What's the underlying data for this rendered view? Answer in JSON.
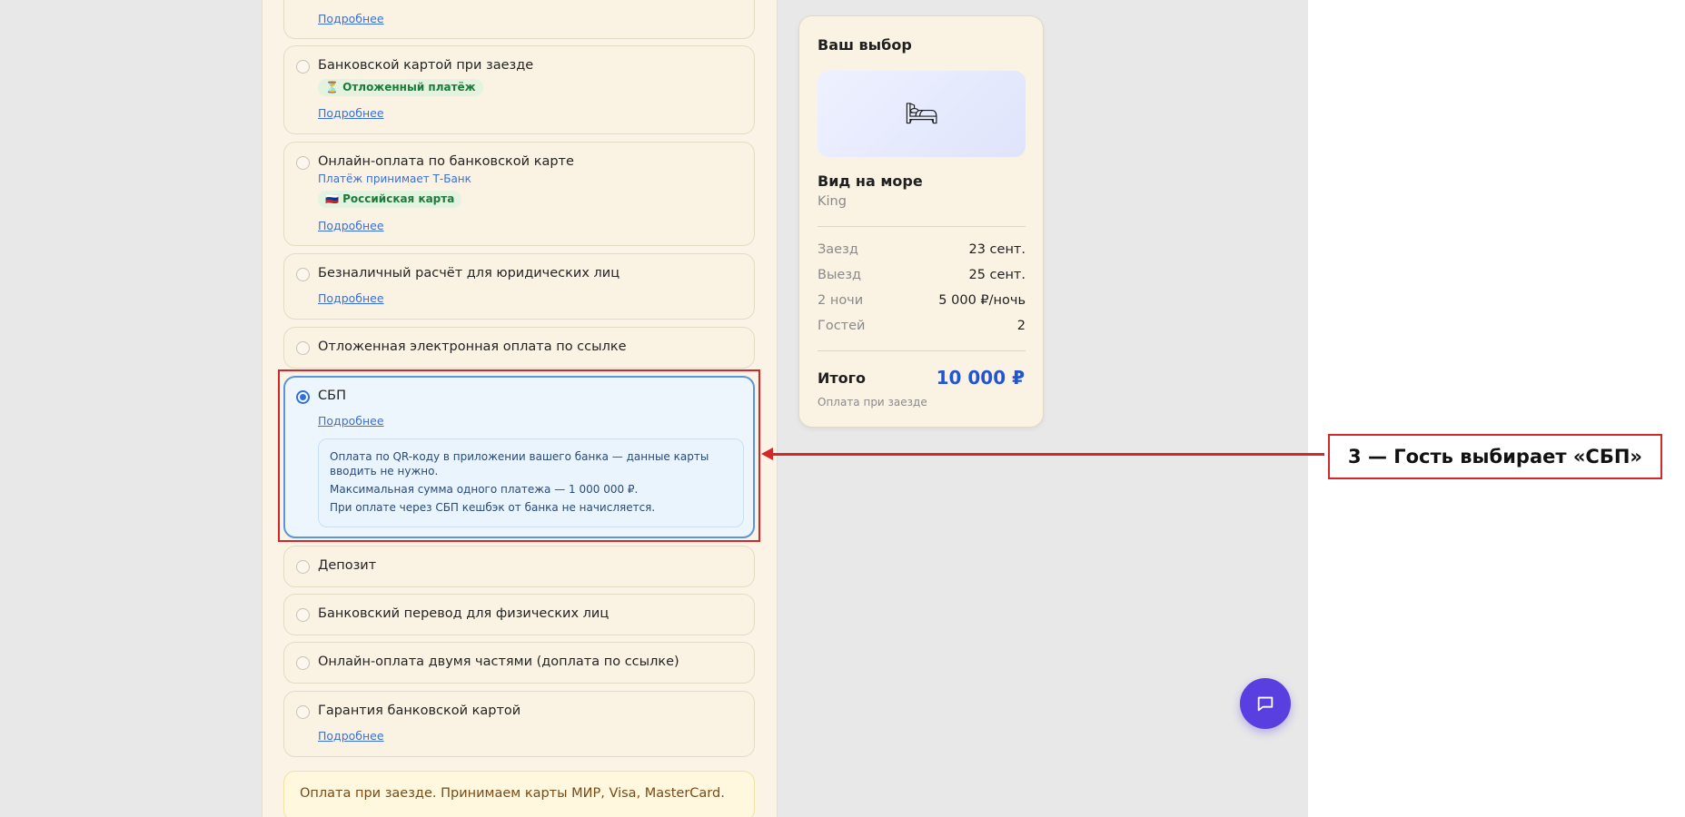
{
  "payment_options": [
    {
      "title": "",
      "link": "Подробнее"
    },
    {
      "title": "Банковской картой при заезде",
      "badge": "⏳ Отложенный платёж",
      "link": "Подробнее"
    },
    {
      "title": "Онлайн-оплата по банковской карте",
      "subtitle": "Платёж принимает Т-Банк",
      "badge": "🇷🇺 Российская карта",
      "link": "Подробнее"
    },
    {
      "title": "Безналичный расчёт для юридических лиц",
      "link": "Подробнее"
    },
    {
      "title": "Отложенная электронная оплата по ссылке"
    },
    {
      "title": "СБП",
      "link": "Подробнее",
      "selected": true,
      "info": [
        "Оплата по QR-коду в приложении вашего банка — данные карты вводить не нужно.",
        "Максимальная сумма одного платежа — 1 000 000 ₽.",
        "При оплате через СБП кешбэк от банка не начисляется."
      ]
    },
    {
      "title": "Депозит"
    },
    {
      "title": "Банковский перевод для физических лиц"
    },
    {
      "title": "Онлайн-оплата двумя частями (доплата по ссылке)"
    },
    {
      "title": "Гарантия банковской картой",
      "link": "Подробнее"
    }
  ],
  "footer_note": "Оплата при заезде. Принимаем карты МИР, Visa, MasterCard.",
  "summary": {
    "title": "Ваш выбор",
    "image_icon": "🛏",
    "room_name": "Вид на море",
    "room_type": "King",
    "rows": [
      {
        "label": "Заезд",
        "value": "23 сент."
      },
      {
        "label": "Выезд",
        "value": "25 сент."
      },
      {
        "label": "2 ночи",
        "value": "5 000 ₽/ночь"
      },
      {
        "label": "Гостей",
        "value": "2"
      }
    ],
    "total_label": "Итого",
    "total_value": "10 000 ₽",
    "total_note": "Оплата при заезде"
  },
  "callout": "3 — Гость выбирает «СБП»",
  "colors": {
    "accent_blue": "#2355d2",
    "chat_fab": "#5a3fe0",
    "annotation_red": "#d42828"
  }
}
